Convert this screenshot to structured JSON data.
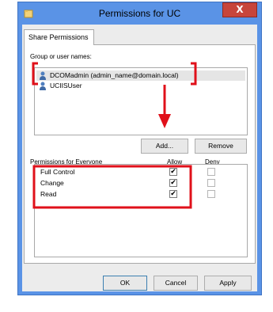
{
  "window": {
    "title": "Permissions for UC",
    "close_glyph": "X",
    "icon": "folder-icon",
    "accent": "#5a93e6"
  },
  "tab": {
    "label": "Share Permissions"
  },
  "group_label": "Group or user names:",
  "users": [
    {
      "name": "DCOMadmin (admin_name@domain.local)",
      "icon": "user-icon",
      "selected": true
    },
    {
      "name": "UCIISUser",
      "icon": "user-icon",
      "selected": false
    }
  ],
  "buttons": {
    "add": "Add...",
    "remove": "Remove",
    "ok": "OK",
    "cancel": "Cancel",
    "apply": "Apply"
  },
  "permissions": {
    "label": "Permissions for Everyone",
    "allow_header": "Allow",
    "deny_header": "Deny",
    "rows": [
      {
        "name": "Full Control",
        "allow": true,
        "deny": false
      },
      {
        "name": "Change",
        "allow": true,
        "deny": false
      },
      {
        "name": "Read",
        "allow": true,
        "deny": false
      }
    ]
  },
  "check_glyph": "✔",
  "annotation_color": "#e0101a"
}
